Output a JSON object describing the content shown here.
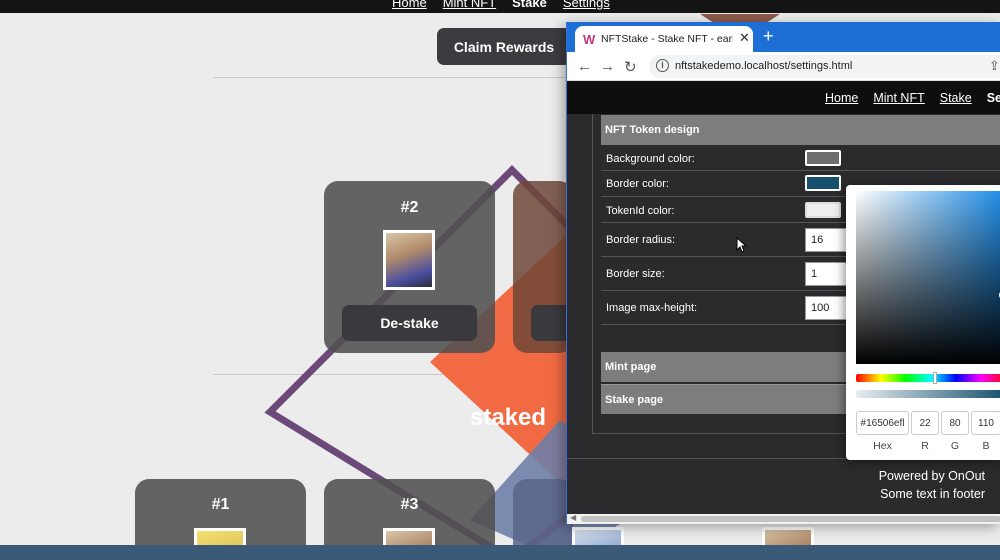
{
  "background_page": {
    "nav_links": [
      "Home",
      "Mint NFT",
      "Stake",
      "Settings"
    ],
    "claim_button": "Claim Rewards",
    "staked_cards": [
      {
        "id": "#2",
        "button": "De-stake"
      }
    ],
    "staked_heading": "staked",
    "unstaked_cards": [
      {
        "id": "#1"
      },
      {
        "id": "#3"
      }
    ]
  },
  "browser": {
    "tab_title": "NFTStake - Stake NFT - earn ERC",
    "url": "nftstakedemo.localhost/settings.html"
  },
  "settings_page": {
    "nav_links": [
      "Home",
      "Mint NFT",
      "Stake",
      "Se"
    ],
    "sections": {
      "nft_token_design": "NFT Token design",
      "mint_page": "Mint page",
      "stake_page": "Stake page"
    },
    "rows": {
      "background_color": "Background color:",
      "border_color": "Border color:",
      "tokenid_color": "TokenId color:",
      "border_radius": "Border radius:",
      "border_size": "Border size:",
      "image_max_height": "Image max-height:"
    },
    "values": {
      "border_radius": "16",
      "border_size": "1",
      "image_max_height": "100"
    },
    "swatch_colors": {
      "background": "#6e6e6e",
      "border": "#16506e",
      "tokenid": "#eeeeee"
    },
    "footer": {
      "line1": "Powered by OnOut",
      "line2": "Some text in footer"
    }
  },
  "color_picker": {
    "hex": "#16506efl",
    "r": "22",
    "g": "80",
    "b": "110",
    "labels": {
      "hex": "Hex",
      "r": "R",
      "g": "G",
      "b": "B"
    }
  }
}
